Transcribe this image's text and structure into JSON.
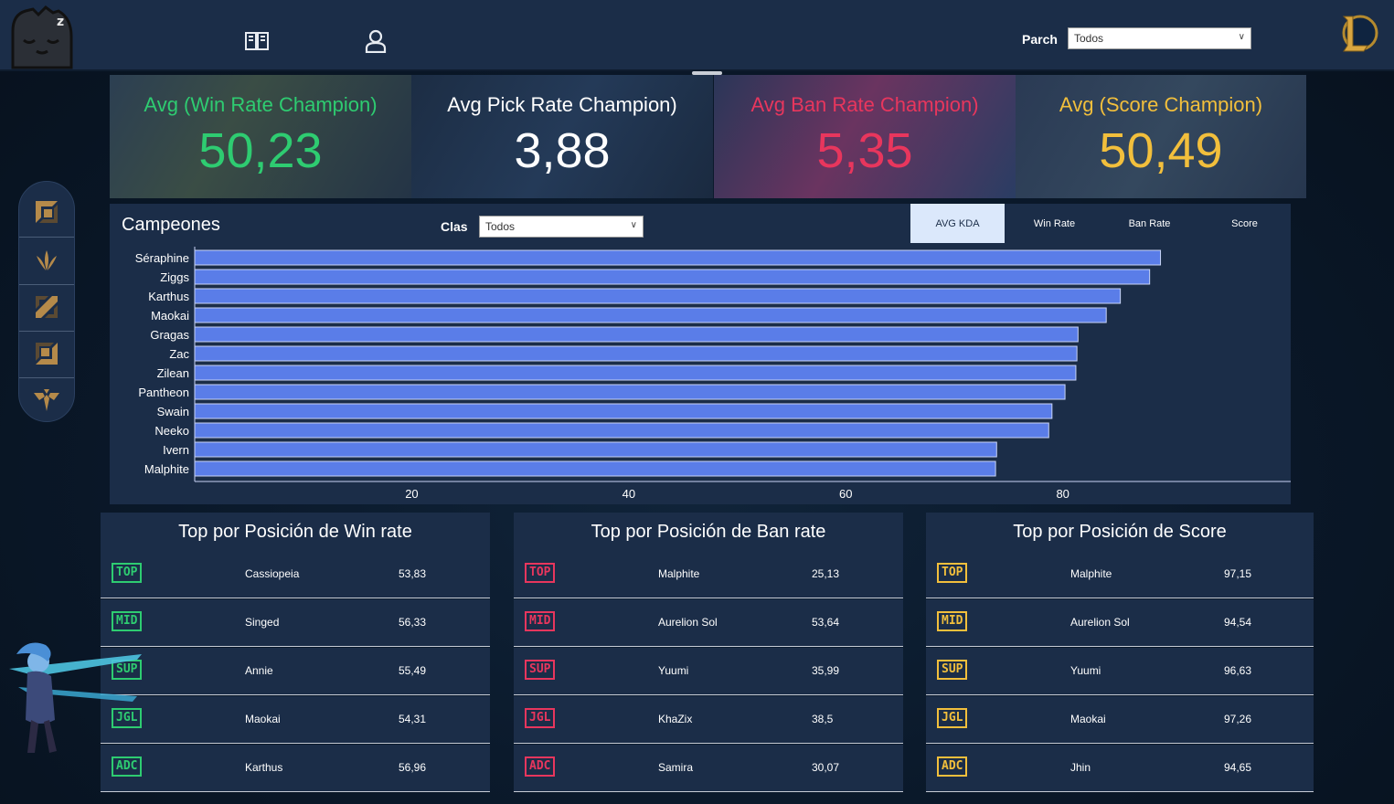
{
  "header": {
    "patch_label": "Parch",
    "patch_select": "Todos",
    "icons": [
      "book-icon",
      "user-icon"
    ],
    "logo_right": "league-of-legends-logo"
  },
  "kpis": [
    {
      "title": "Avg (Win Rate Champion)",
      "value": "50,23",
      "color": "#2ecc71"
    },
    {
      "title": "Avg Pick Rate Champion)",
      "value": "3,88",
      "color": "#ffffff"
    },
    {
      "title": "Avg Ban Rate Champion)",
      "value": "5,35",
      "color": "#e8365d"
    },
    {
      "title": "Avg (Score Champion)",
      "value": "50,49",
      "color": "#f2bf3c"
    }
  ],
  "sidebar": {
    "items": [
      "top-role-icon",
      "jungle-role-icon",
      "mid-role-icon",
      "bottom-role-icon",
      "support-role-icon"
    ]
  },
  "chart_panel": {
    "title": "Campeones",
    "class_label": "Clas",
    "class_select": "Todos",
    "tabs": [
      "AVG KDA",
      "Win Rate",
      "Ban Rate",
      "Score"
    ],
    "active_tab": "AVG KDA"
  },
  "chart_data": {
    "type": "bar",
    "orientation": "horizontal",
    "categories": [
      "Séraphine",
      "Ziggs",
      "Karthus",
      "Maokai",
      "Gragas",
      "Zac",
      "Zilean",
      "Pantheon",
      "Swain",
      "Neeko",
      "Ivern",
      "Malphite"
    ],
    "values": [
      89.0,
      88.0,
      85.3,
      84.0,
      81.4,
      81.3,
      81.2,
      80.2,
      79.0,
      78.7,
      73.9,
      73.8
    ],
    "xticks": [
      20,
      40,
      60,
      80
    ],
    "xlim": [
      0,
      101
    ],
    "bar_color": "#5a7de8",
    "grid": false
  },
  "tables": [
    {
      "title": "Top por Posición de Win rate",
      "badge_color": "#2ecc71",
      "rows": [
        {
          "role": "TOP",
          "name": "Cassiopeia",
          "value": "53,83"
        },
        {
          "role": "MID",
          "name": "Singed",
          "value": "56,33"
        },
        {
          "role": "SUP",
          "name": "Annie",
          "value": "55,49"
        },
        {
          "role": "JGL",
          "name": "Maokai",
          "value": "54,31"
        },
        {
          "role": "ADC",
          "name": "Karthus",
          "value": "56,96"
        }
      ]
    },
    {
      "title": "Top por Posición de Ban rate",
      "badge_color": "#e8365d",
      "rows": [
        {
          "role": "TOP",
          "name": "Malphite",
          "value": "25,13"
        },
        {
          "role": "MID",
          "name": "Aurelion Sol",
          "value": "53,64"
        },
        {
          "role": "SUP",
          "name": "Yuumi",
          "value": "35,99"
        },
        {
          "role": "JGL",
          "name": "KhaZix",
          "value": "38,5"
        },
        {
          "role": "ADC",
          "name": "Samira",
          "value": "30,07"
        }
      ]
    },
    {
      "title": "Top por Posición de Score",
      "badge_color": "#f2bf3c",
      "rows": [
        {
          "role": "TOP",
          "name": "Malphite",
          "value": "97,15"
        },
        {
          "role": "MID",
          "name": "Aurelion Sol",
          "value": "94,54"
        },
        {
          "role": "SUP",
          "name": "Yuumi",
          "value": "96,63"
        },
        {
          "role": "JGL",
          "name": "Maokai",
          "value": "97,26"
        },
        {
          "role": "ADC",
          "name": "Jhin",
          "value": "94,65"
        }
      ]
    }
  ]
}
